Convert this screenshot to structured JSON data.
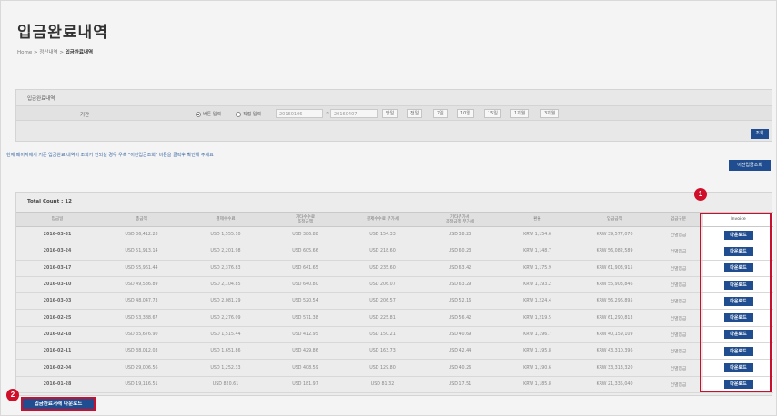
{
  "page": {
    "title": "입금완료내역"
  },
  "breadcrumb": {
    "home": "Home",
    "sep1": ">",
    "parent": "정산내역",
    "sep2": ">",
    "current": "입금완료내역"
  },
  "search": {
    "panel_title": "입금완료내역",
    "period_label": "기간",
    "radio_button_label": "버튼 입력",
    "radio_direct_label": "직접 입력",
    "radio_selected": "버튼 입력",
    "start_date": "20160106",
    "tilde": "~",
    "end_date": "20160407",
    "period_buttons": [
      "당일",
      "전일",
      "7일",
      "10일",
      "15일",
      "1개월",
      "3개월"
    ],
    "search_button": "조회"
  },
  "notice": "현재 페이지에서 기존 입금완료 내역이 조회가 안되실 경우 우측 \"이전입금조회\" 버튼을 클릭후 확인해 주세요",
  "prev_button": "이전입금조회",
  "table": {
    "total_count": "Total Count : 12",
    "headers": [
      "입금일",
      "총금액",
      "결제수수료",
      "기타수수료\n조정금액",
      "결제수수료 부가세",
      "기타부가세\n조정금액 부가세",
      "환율",
      "입금금액",
      "입금구분",
      "Invoice"
    ],
    "download_label": "다운로드",
    "rows": [
      [
        "2016-03-31",
        "USD 36,412.28",
        "USD 1,555.10",
        "USD 386.88",
        "USD 154.33",
        "USD 38.23",
        "KRW 1,154.6",
        "KRW 39,577,070",
        "건별입금"
      ],
      [
        "2016-03-24",
        "USD 51,913.14",
        "USD 2,201.98",
        "USD 605.66",
        "USD 218.60",
        "USD 60.23",
        "KRW 1,148.7",
        "KRW 56,082,589",
        "건별입금"
      ],
      [
        "2016-03-17",
        "USD 55,961.44",
        "USD 2,376.83",
        "USD 641.65",
        "USD 235.60",
        "USD 63.42",
        "KRW 1,175.9",
        "KRW 61,903,915",
        "건별입금"
      ],
      [
        "2016-03-10",
        "USD 49,536.89",
        "USD 2,104.85",
        "USD 640.80",
        "USD 206.07",
        "USD 63.29",
        "KRW 1,193.2",
        "KRW 55,903,846",
        "건별입금"
      ],
      [
        "2016-03-03",
        "USD 48,047.73",
        "USD 2,081.29",
        "USD 520.54",
        "USD 206.57",
        "USD 52.16",
        "KRW 1,224.4",
        "KRW 56,296,895",
        "건별입금"
      ],
      [
        "2016-02-25",
        "USD 53,388.67",
        "USD 2,276.09",
        "USD 571.38",
        "USD 225.81",
        "USD 56.42",
        "KRW 1,219.5",
        "KRW 61,290,813",
        "건별입금"
      ],
      [
        "2016-02-18",
        "USD 35,676.90",
        "USD 1,515.44",
        "USD 412.95",
        "USD 150.21",
        "USD 40.69",
        "KRW 1,196.7",
        "KRW 40,159,109",
        "건별입금"
      ],
      [
        "2016-02-11",
        "USD 38,012.03",
        "USD 1,651.86",
        "USD 429.86",
        "USD 163.73",
        "USD 42.44",
        "KRW 1,195.8",
        "KRW 43,310,396",
        "건별입금"
      ],
      [
        "2016-02-04",
        "USD 29,006.56",
        "USD 1,252.33",
        "USD 408.59",
        "USD 129.80",
        "USD 40.26",
        "KRW 1,190.6",
        "KRW 33,313,320",
        "건별입금"
      ],
      [
        "2016-01-28",
        "USD 19,116.51",
        "USD 820.61",
        "USD 181.97",
        "USD 81.32",
        "USD 17.51",
        "KRW 1,185.8",
        "KRW 21,335,040",
        "건별입금"
      ]
    ]
  },
  "bulk_download_button": "입금완료거래 다운로드",
  "markers": [
    "1",
    "2"
  ],
  "colors": {
    "primary_button": "#1f4d8f",
    "highlight_red": "#c8102e",
    "marker_red": "#d0102a",
    "notice_text": "#2f5fa0"
  }
}
